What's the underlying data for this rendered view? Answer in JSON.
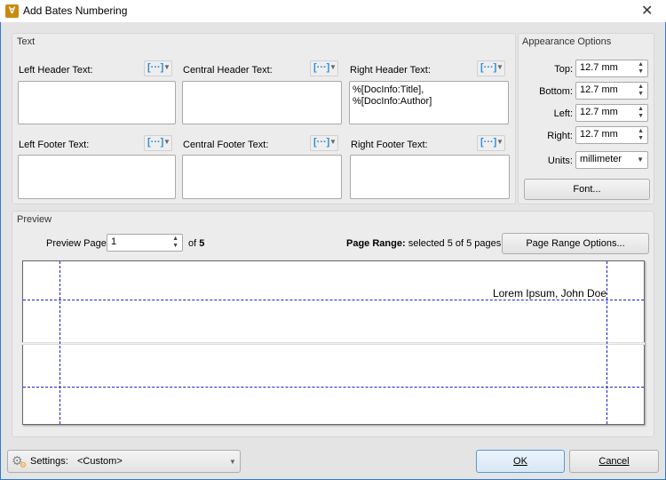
{
  "window": {
    "title": "Add Bates Numbering",
    "close_icon": "close-icon"
  },
  "text_group": {
    "label": "Text",
    "left_header": {
      "label": "Left Header Text:",
      "value": ""
    },
    "central_header": {
      "label": "Central Header Text:",
      "value": ""
    },
    "right_header": {
      "label": "Right Header Text:",
      "value": "%[DocInfo:Title],\n%[DocInfo:Author]"
    },
    "left_footer": {
      "label": "Left Footer Text:",
      "value": ""
    },
    "central_footer": {
      "label": "Central Footer Text:",
      "value": ""
    },
    "right_footer": {
      "label": "Right Footer Text:",
      "value": ""
    },
    "macro_button_glyph": "[···]"
  },
  "appearance": {
    "label": "Appearance Options",
    "top": {
      "label": "Top:",
      "value": "12.7 mm"
    },
    "bottom": {
      "label": "Bottom:",
      "value": "12.7 mm"
    },
    "left": {
      "label": "Left:",
      "value": "12.7 mm"
    },
    "right": {
      "label": "Right:",
      "value": "12.7 mm"
    },
    "units": {
      "label": "Units:",
      "value": "millimeter"
    },
    "font_button": "Font..."
  },
  "preview": {
    "label": "Preview",
    "page_label": "Preview Page",
    "page_value": "1",
    "of_label": "of",
    "page_total": "5",
    "range_label": "Page Range:",
    "range_text": "selected 5 of 5 pages",
    "range_button": "Page Range Options...",
    "header_sample": "Lorem Ipsum, John Doe"
  },
  "footer": {
    "settings_label": "Settings:",
    "settings_value": "<Custom>",
    "ok": "OK",
    "cancel": "Cancel"
  }
}
